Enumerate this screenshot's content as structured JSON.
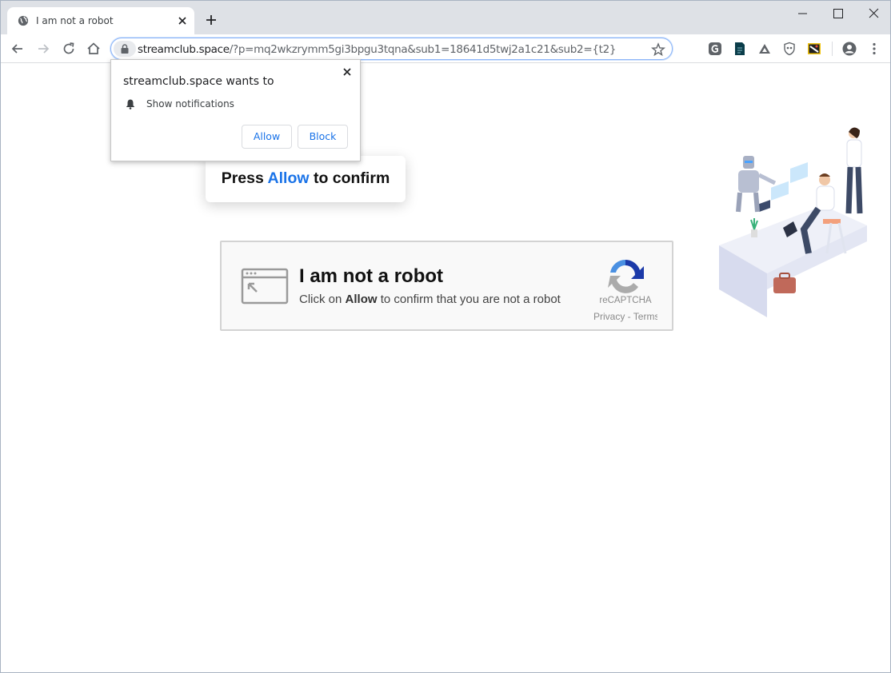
{
  "browser": {
    "tab_title": "I am not a robot",
    "url_host": "streamclub.space",
    "url_path": "/?p=mq2wkzrymm5gi3bpgu3tqna&sub1=18641d5twj2a1c21&sub2={t2}"
  },
  "popup": {
    "title": "streamclub.space wants to",
    "permission": "Show notifications",
    "allow_label": "Allow",
    "block_label": "Block"
  },
  "page": {
    "press_prefix": "Press",
    "press_highlight": "Allow",
    "press_suffix": "to confirm",
    "captcha_heading": "I am not a robot",
    "captcha_sub_prefix": "Click on",
    "captcha_sub_bold": "Allow",
    "captcha_sub_suffix": "to confirm that you are not a robot",
    "captcha_brand": "reCAPTCHA",
    "captcha_links": "Privacy - Terms"
  },
  "colors": {
    "accent": "#1a73e8",
    "tabstrip": "#dee1e6"
  },
  "icons": {
    "favicon": "globe-icon",
    "lock": "lock-icon",
    "bell": "bell-icon"
  }
}
